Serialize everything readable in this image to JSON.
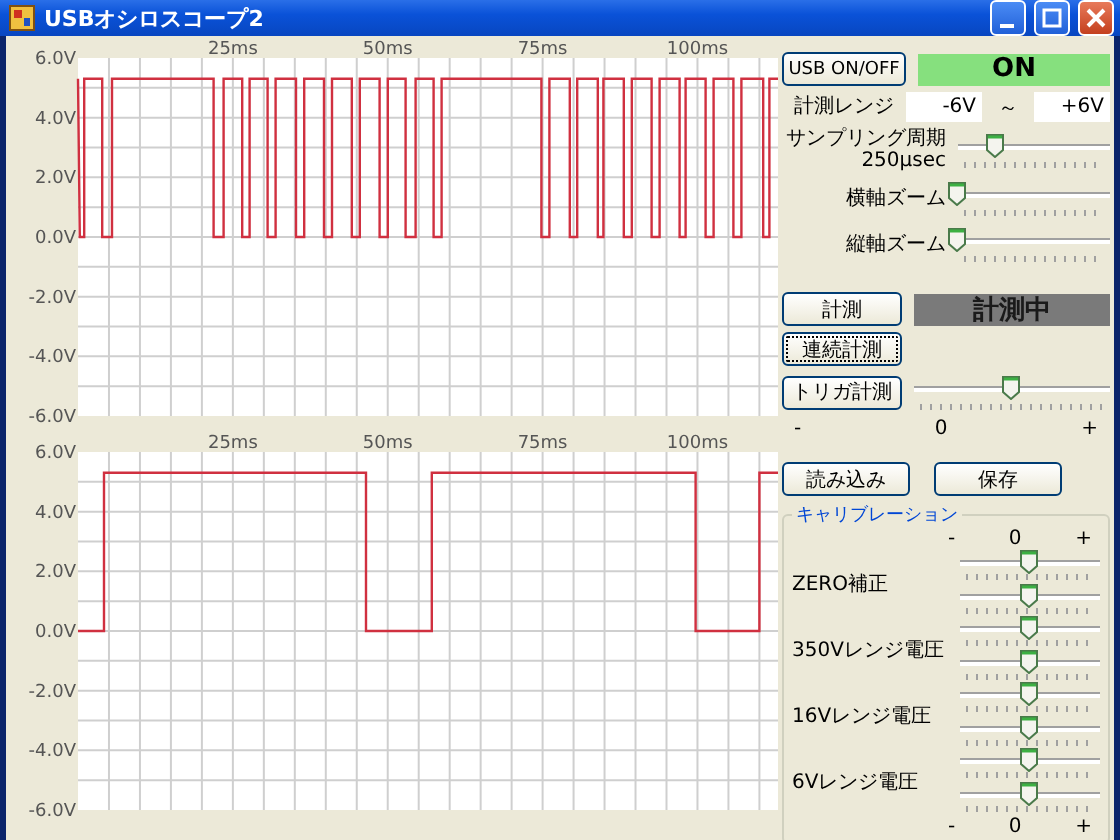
{
  "window": {
    "title": "USBオシロスコープ2"
  },
  "charts": [
    {
      "chart_data": {
        "type": "line",
        "grid": true,
        "xlim": [
          0,
          113
        ],
        "ylim": [
          -6,
          6
        ],
        "xticks": [
          {
            "value": 25,
            "label": "25ms"
          },
          {
            "value": 50,
            "label": "50ms"
          },
          {
            "value": 75,
            "label": "75ms"
          },
          {
            "value": 100,
            "label": "100ms"
          }
        ],
        "yticks": [
          {
            "value": 6,
            "label": "6.0V"
          },
          {
            "value": 4,
            "label": "4.0V"
          },
          {
            "value": 2,
            "label": "2.0V"
          },
          {
            "value": 0,
            "label": "0.0V"
          },
          {
            "value": -2,
            "label": "-2.0V"
          },
          {
            "value": -4,
            "label": "-4.0V"
          },
          {
            "value": -6,
            "label": "-6.0V"
          }
        ],
        "x": [
          0,
          0.3,
          1.0,
          1.0,
          3.9,
          3.9,
          5.5,
          5.5,
          21.9,
          21.9,
          23.5,
          23.5,
          26.5,
          26.5,
          27.7,
          27.7,
          30.6,
          30.6,
          31.9,
          31.9,
          35.2,
          35.2,
          36.5,
          36.5,
          39.7,
          39.7,
          41.0,
          41.0,
          44.2,
          44.2,
          45.5,
          45.5,
          48.7,
          48.7,
          50.0,
          50.0,
          52.9,
          52.9,
          54.5,
          54.5,
          57.4,
          57.4,
          58.7,
          58.7,
          74.8,
          74.8,
          76.1,
          76.1,
          79.4,
          79.4,
          80.6,
          80.6,
          83.9,
          83.9,
          84.8,
          84.8,
          88.1,
          88.1,
          89.4,
          89.4,
          92.6,
          92.6,
          93.9,
          93.9,
          97.1,
          97.1,
          98.1,
          98.1,
          101.3,
          101.3,
          102.6,
          102.6,
          105.8,
          105.8,
          107.1,
          107.1,
          110.6,
          110.6,
          111.6,
          111.6,
          113
        ],
        "series": [
          {
            "color": "#d03040",
            "values": [
              5.3,
              0,
              0,
              5.3,
              5.3,
              0,
              0,
              5.3,
              5.3,
              0,
              0,
              5.3,
              5.3,
              0,
              0,
              5.3,
              5.3,
              0,
              0,
              5.3,
              5.3,
              0,
              0,
              5.3,
              5.3,
              0,
              0,
              5.3,
              5.3,
              0,
              0,
              5.3,
              5.3,
              0,
              0,
              5.3,
              5.3,
              0,
              0,
              5.3,
              5.3,
              0,
              0,
              5.3,
              5.3,
              0,
              0,
              5.3,
              5.3,
              0,
              0,
              5.3,
              5.3,
              0,
              0,
              5.3,
              5.3,
              0,
              0,
              5.3,
              5.3,
              0,
              0,
              5.3,
              5.3,
              0,
              0,
              5.3,
              5.3,
              0,
              0,
              5.3,
              5.3,
              0,
              0,
              5.3,
              5.3,
              0,
              0,
              5.3,
              5.3
            ]
          }
        ]
      }
    },
    {
      "chart_data": {
        "type": "line",
        "grid": true,
        "xlim": [
          0,
          113
        ],
        "ylim": [
          -6,
          6
        ],
        "xticks": [
          {
            "value": 25,
            "label": "25ms"
          },
          {
            "value": 50,
            "label": "50ms"
          },
          {
            "value": 75,
            "label": "75ms"
          },
          {
            "value": 100,
            "label": "100ms"
          }
        ],
        "yticks": [
          {
            "value": 6,
            "label": "6.0V"
          },
          {
            "value": 4,
            "label": "4.0V"
          },
          {
            "value": 2,
            "label": "2.0V"
          },
          {
            "value": 0,
            "label": "0.0V"
          },
          {
            "value": -2,
            "label": "-2.0V"
          },
          {
            "value": -4,
            "label": "-4.0V"
          },
          {
            "value": -6,
            "label": "-6.0V"
          }
        ],
        "x": [
          0,
          4.2,
          4.2,
          46.5,
          46.5,
          57.1,
          57.1,
          99.7,
          99.7,
          110,
          110,
          113
        ],
        "series": [
          {
            "color": "#d03040",
            "values": [
              0,
              0,
              5.3,
              5.3,
              0,
              0,
              5.3,
              5.3,
              0,
              0,
              5.3,
              5.3
            ]
          }
        ]
      }
    }
  ],
  "controls": {
    "usb_button": "USB ON/OFF",
    "usb_status": "ON",
    "range_label": "計測レンジ",
    "range_min": "-6V",
    "range_sep": "～",
    "range_max": "+6V",
    "sliders": [
      {
        "label": "サンプリング周期",
        "sub": "250μsec",
        "level": 0.25
      },
      {
        "label": "横軸ズーム",
        "level": 0
      },
      {
        "label": "縦軸ズーム",
        "level": 0
      }
    ],
    "measure_button": "計測",
    "measure_status": "計測中",
    "continuous_button": {
      "label": "連続計測",
      "focused": true
    },
    "trigger_button": "トリガ計測",
    "trigger_slider": {
      "level": 0.5,
      "min": "-",
      "mid": "0",
      "max": "+"
    },
    "load_button": "読み込み",
    "save_button": "保存",
    "calibration": {
      "title": "キャリブレーション",
      "scale_top": {
        "min": "-",
        "mid": "0",
        "max": "+"
      },
      "rows": [
        {
          "label": "ZERO補正",
          "sliders": [
            {
              "level": 0.5
            },
            {
              "level": 0.5
            }
          ]
        },
        {
          "label": "350Vレンジ電圧",
          "sliders": [
            {
              "level": 0.5
            },
            {
              "level": 0.5
            }
          ]
        },
        {
          "label": "16Vレンジ電圧",
          "sliders": [
            {
              "level": 0.5
            },
            {
              "level": 0.5
            }
          ]
        },
        {
          "label": "6Vレンジ電圧",
          "sliders": [
            {
              "level": 0.5
            },
            {
              "level": 0.5
            }
          ]
        }
      ],
      "scale_bottom": {
        "min": "-",
        "mid": "0",
        "max": "+"
      }
    }
  }
}
